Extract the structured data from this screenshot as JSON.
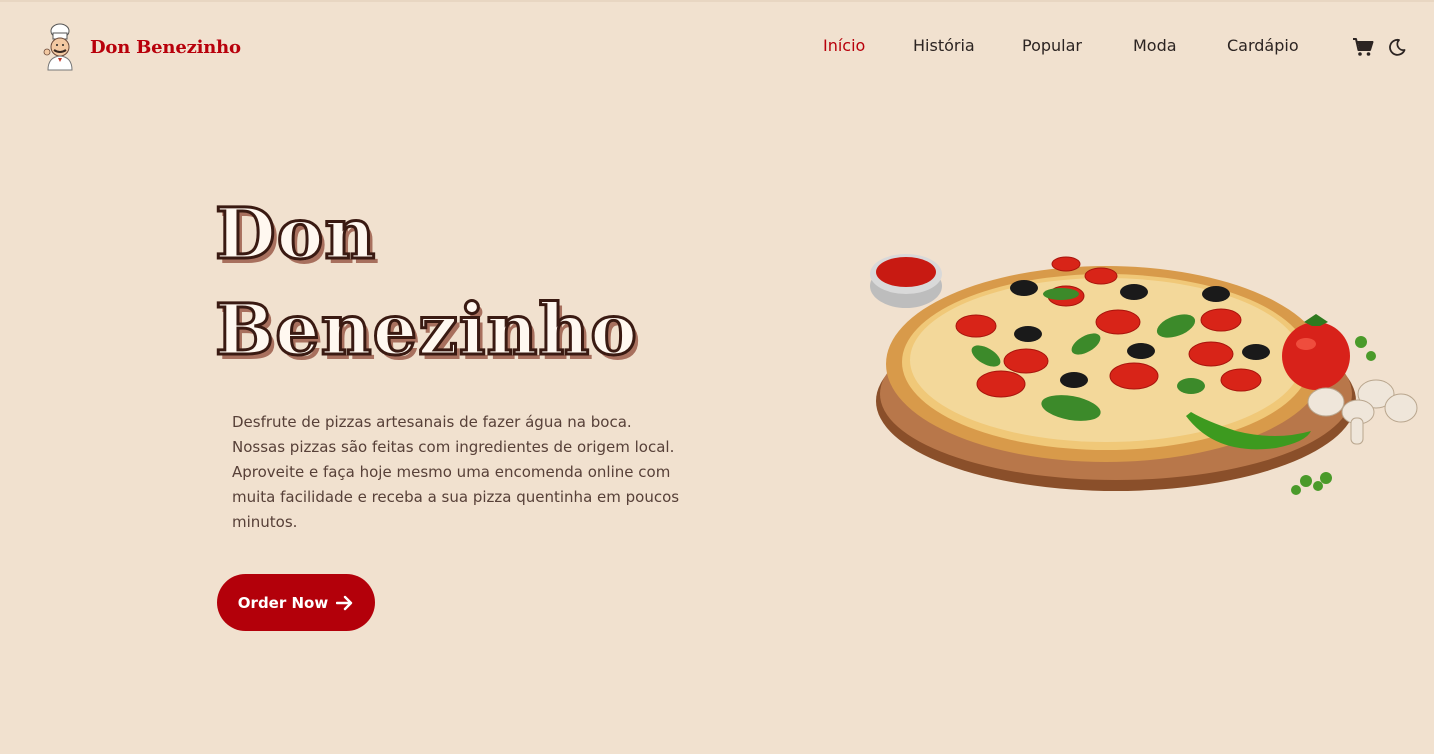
{
  "brand": {
    "name": "Don Benezinho",
    "logo_icon": "chef-icon"
  },
  "nav": {
    "items": [
      {
        "label": "Início",
        "active": true
      },
      {
        "label": "História",
        "active": false
      },
      {
        "label": "Popular",
        "active": false
      },
      {
        "label": "Moda",
        "active": false
      },
      {
        "label": "Cardápio",
        "active": false
      }
    ],
    "cart_icon": "cart-icon",
    "theme_icon": "moon-icon"
  },
  "hero": {
    "title_line1": "Don",
    "title_line2": "Benezinho",
    "description": "Desfrute de pizzas artesanais de fazer água na boca. Nossas pizzas são feitas com ingredientes de origem local. Aproveite e faça hoje mesmo uma encomenda online com muita facilidade e receba a sua pizza quentinha em poucos minutos.",
    "cta_label": "Order Now",
    "cta_icon": "arrow-right-icon",
    "image": "pizza-image"
  },
  "colors": {
    "background": "#f1e1cf",
    "accent": "#b8000b",
    "button": "#b3000a",
    "text": "#2c2422"
  }
}
